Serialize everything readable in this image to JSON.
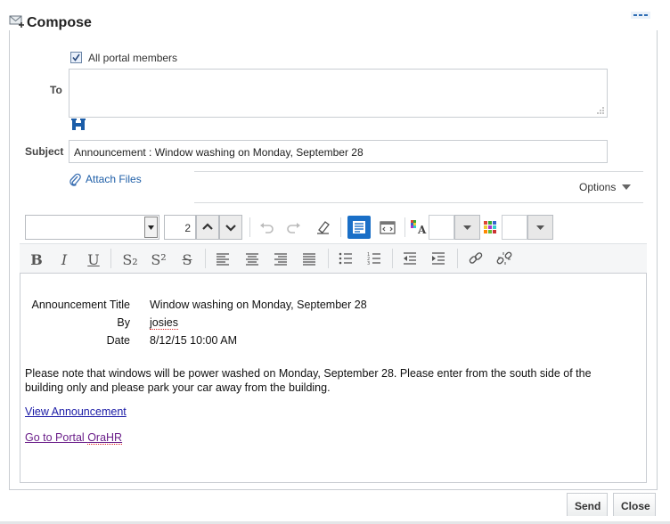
{
  "window": {
    "title": "Compose"
  },
  "recipients": {
    "all_members_label": "All portal members",
    "all_members_checked": true
  },
  "to": {
    "label": "To",
    "value": ""
  },
  "subject": {
    "label": "Subject",
    "value": "Announcement : Window washing on Monday, September 28"
  },
  "attach": {
    "label": "Attach Files"
  },
  "options": {
    "label": "Options"
  },
  "toolbar": {
    "font_size": "2",
    "icons": [
      "undo-icon",
      "redo-icon",
      "eraser-icon",
      "rich-text-mode-icon",
      "source-mode-icon",
      "font-color-icon",
      "highlight-color-icon",
      "bold-icon",
      "italic-icon",
      "underline-icon",
      "subscript-icon",
      "superscript-icon",
      "strikethrough-icon",
      "align-left-icon",
      "align-center-icon",
      "align-right-icon",
      "justify-icon",
      "bullet-list-icon",
      "numbered-list-icon",
      "outdent-icon",
      "indent-icon",
      "link-icon",
      "unlink-icon"
    ],
    "bold": "B",
    "italic": "I",
    "underline": "U",
    "subscript": "S₂",
    "superscript": "S²",
    "strike": "S"
  },
  "message": {
    "announcement_title_label": "Announcement Title",
    "announcement_title_value": "Window washing on Monday, September 28",
    "by_label": "By",
    "by_value": "josies",
    "date_label": "Date",
    "date_value": "8/12/15 10:00 AM",
    "body": "Please note that windows will be power washed on Monday, September 28. Please enter from the south side of the building only and please park your car away from the building.",
    "link_view": "View Announcement",
    "link_portal_prefix": "Go to Portal ",
    "link_portal_name": "OraHR"
  },
  "footer": {
    "send_label": "Send",
    "close_label": "Close"
  },
  "colors": {
    "accent": "#1a6fc7",
    "link": "#1a1aa6",
    "visited_link": "#6b1f8a",
    "border": "#c9cdd2"
  }
}
